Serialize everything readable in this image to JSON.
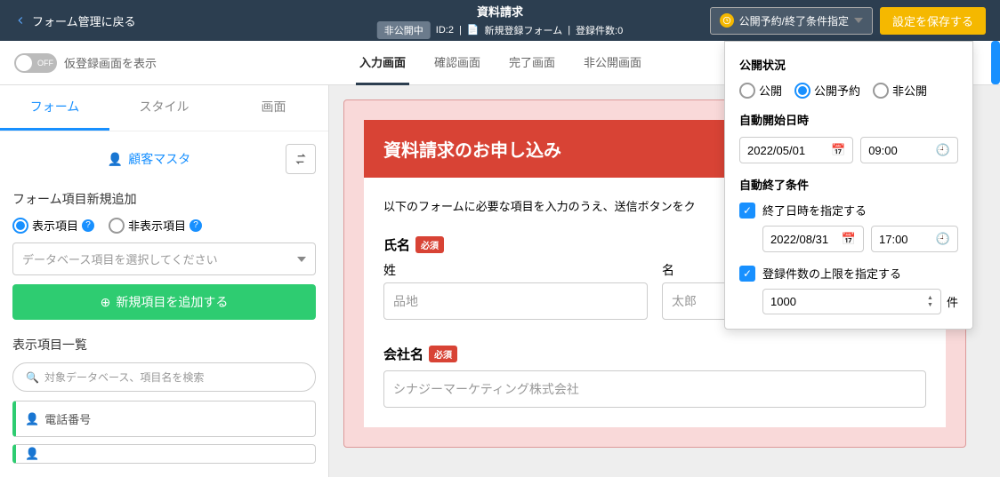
{
  "header": {
    "back_label": "フォーム管理に戻る",
    "title": "資料請求",
    "status_badge": "非公開中",
    "form_id": "ID:2",
    "form_type": "新規登録フォーム",
    "reg_count": "登録件数:0",
    "dropdown_label": "公開予約/終了条件指定",
    "save_label": "設定を保存する"
  },
  "toggle": {
    "state": "OFF",
    "label": "仮登録画面を表示"
  },
  "screen_tabs": [
    "入力画面",
    "確認画面",
    "完了画面",
    "非公開画面"
  ],
  "side_tabs": [
    "フォーム",
    "スタイル",
    "画面"
  ],
  "sidebar": {
    "master_label": "顧客マスタ",
    "add_section": "フォーム項目新規追加",
    "radio_show": "表示項目",
    "radio_hide": "非表示項目",
    "select_placeholder": "データベース項目を選択してください",
    "add_button": "新規項目を追加する",
    "list_title": "表示項目一覧",
    "search_placeholder": "対象データベース、項目名を検索",
    "items": [
      "電話番号"
    ]
  },
  "form": {
    "heading": "資料請求のお申し込み",
    "intro": "以下のフォームに必要な項目を入力のうえ、送信ボタンをク",
    "required": "必須",
    "name_label": "氏名",
    "lastname_label": "姓",
    "lastname_ph": "品地",
    "firstname_label": "名",
    "firstname_ph": "太郎",
    "company_label": "会社名",
    "company_ph": "シナジーマーケティング株式会社"
  },
  "popover": {
    "status_title": "公開状況",
    "radios": [
      "公開",
      "公開予約",
      "非公開"
    ],
    "start_title": "自動開始日時",
    "start_date": "2022/05/01",
    "start_time": "09:00",
    "end_title": "自動終了条件",
    "check_end": "終了日時を指定する",
    "end_date": "2022/08/31",
    "end_time": "17:00",
    "check_limit": "登録件数の上限を指定する",
    "limit_value": "1000",
    "limit_unit": "件"
  }
}
